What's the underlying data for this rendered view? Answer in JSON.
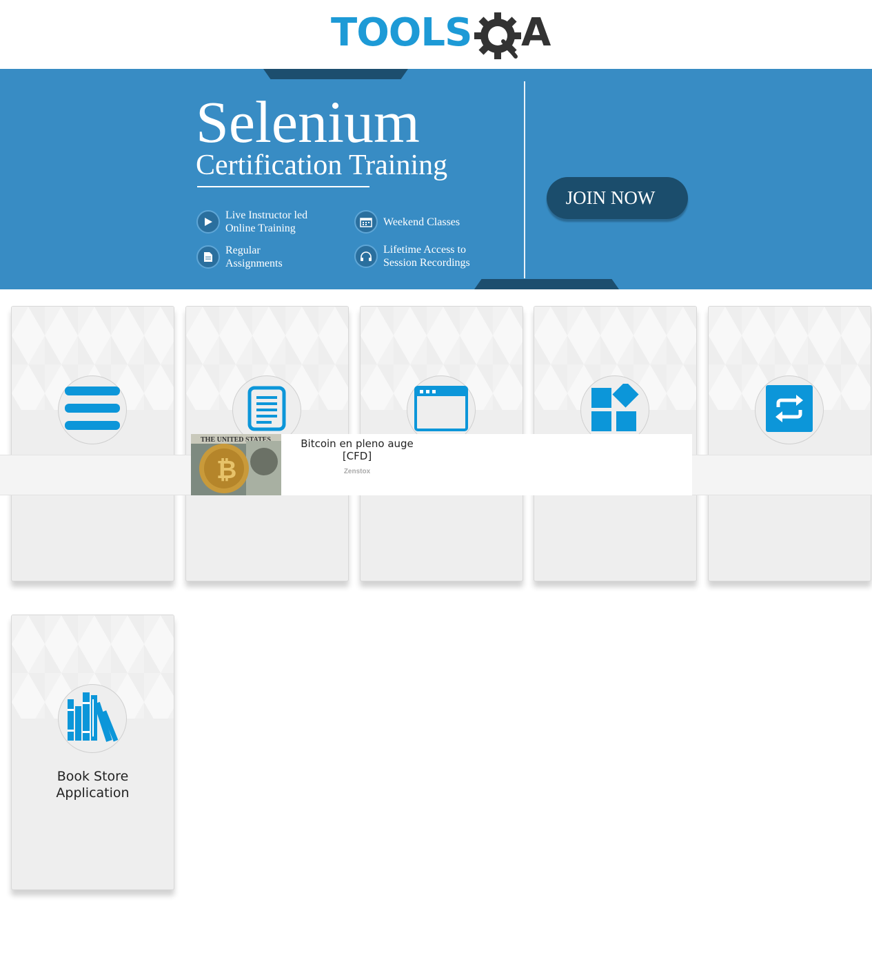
{
  "logo": {
    "text_left": "TOOLS",
    "text_right": "A",
    "alt": "ToolsQA"
  },
  "banner": {
    "title": "Selenium",
    "subtitle": "Certification Training",
    "features": [
      {
        "icon": "play-icon",
        "line1": "Live Instructor led",
        "line2": "Online Training"
      },
      {
        "icon": "calendar-icon",
        "line1": "Weekend Classes",
        "line2": ""
      },
      {
        "icon": "document-icon",
        "line1": "Regular",
        "line2": "Assignments"
      },
      {
        "icon": "headphones-icon",
        "line1": "Lifetime Access to",
        "line2": "Session Recordings"
      }
    ],
    "cta_label": "JOIN NOW"
  },
  "cards": [
    {
      "icon": "hamburger-icon",
      "title": ""
    },
    {
      "icon": "form-icon",
      "title": ""
    },
    {
      "icon": "browser-window-icon",
      "title": ""
    },
    {
      "icon": "widgets-icon",
      "title": ""
    },
    {
      "icon": "interaction-arrows-icon",
      "title": ""
    },
    {
      "icon": "books-icon",
      "title_line1": "Book Store",
      "title_line2": "Application"
    }
  ],
  "ad": {
    "headline_line1": "Bitcoin en pleno auge",
    "headline_line2": "[CFD]",
    "source": "Zenstox",
    "image_caption": "THE UNITED STATES"
  },
  "colors": {
    "brand_blue": "#1d9ad6",
    "logo_dark": "#333333",
    "banner_bg": "#388cc4",
    "banner_dark": "#1b4d6c",
    "card_bg": "#eeeeee",
    "icon_blue": "#0c96d9"
  }
}
